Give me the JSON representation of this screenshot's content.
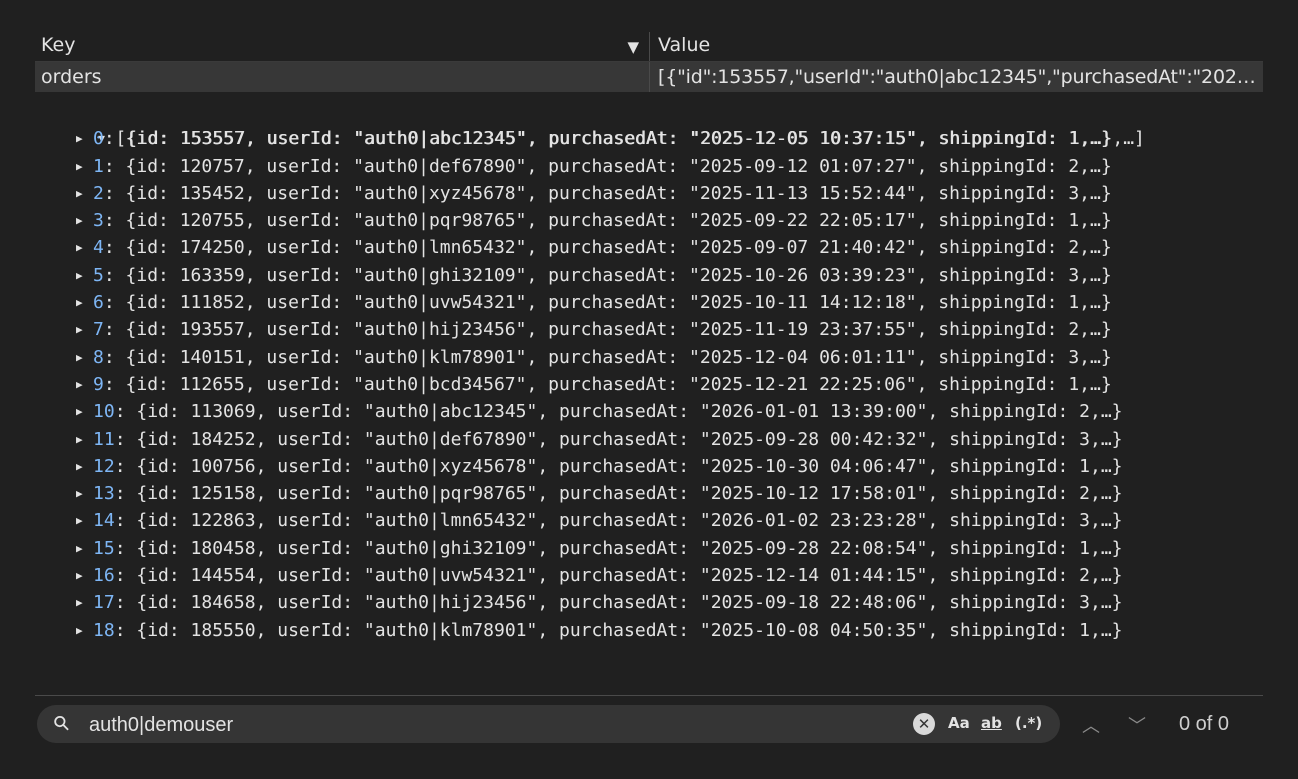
{
  "table": {
    "key_header": "Key",
    "value_header": "Value",
    "row": {
      "key": "orders",
      "value": "[{\"id\":153557,\"userId\":\"auth0|abc12345\",\"purchasedAt\":\"2025-12-..."
    }
  },
  "tree": {
    "root_summary": "[{id: 153557, userId: \"auth0|abc12345\", purchasedAt: \"2025-12-05 10:37:15\", shippingId: 1,…},…]",
    "items": [
      {
        "index": "0",
        "text": ": {id: 153557, userId: \"auth0|abc12345\", purchasedAt: \"2025-12-05 10:37:15\", shippingId: 1,…}"
      },
      {
        "index": "1",
        "text": ": {id: 120757, userId: \"auth0|def67890\", purchasedAt: \"2025-09-12 01:07:27\", shippingId: 2,…}"
      },
      {
        "index": "2",
        "text": ": {id: 135452, userId: \"auth0|xyz45678\", purchasedAt: \"2025-11-13 15:52:44\", shippingId: 3,…}"
      },
      {
        "index": "3",
        "text": ": {id: 120755, userId: \"auth0|pqr98765\", purchasedAt: \"2025-09-22 22:05:17\", shippingId: 1,…}"
      },
      {
        "index": "4",
        "text": ": {id: 174250, userId: \"auth0|lmn65432\", purchasedAt: \"2025-09-07 21:40:42\", shippingId: 2,…}"
      },
      {
        "index": "5",
        "text": ": {id: 163359, userId: \"auth0|ghi32109\", purchasedAt: \"2025-10-26 03:39:23\", shippingId: 3,…}"
      },
      {
        "index": "6",
        "text": ": {id: 111852, userId: \"auth0|uvw54321\", purchasedAt: \"2025-10-11 14:12:18\", shippingId: 1,…}"
      },
      {
        "index": "7",
        "text": ": {id: 193557, userId: \"auth0|hij23456\", purchasedAt: \"2025-11-19 23:37:55\", shippingId: 2,…}"
      },
      {
        "index": "8",
        "text": ": {id: 140151, userId: \"auth0|klm78901\", purchasedAt: \"2025-12-04 06:01:11\", shippingId: 3,…}"
      },
      {
        "index": "9",
        "text": ": {id: 112655, userId: \"auth0|bcd34567\", purchasedAt: \"2025-12-21 22:25:06\", shippingId: 1,…}"
      },
      {
        "index": "10",
        "text": ": {id: 113069, userId: \"auth0|abc12345\", purchasedAt: \"2026-01-01 13:39:00\", shippingId: 2,…}"
      },
      {
        "index": "11",
        "text": ": {id: 184252, userId: \"auth0|def67890\", purchasedAt: \"2025-09-28 00:42:32\", shippingId: 3,…}"
      },
      {
        "index": "12",
        "text": ": {id: 100756, userId: \"auth0|xyz45678\", purchasedAt: \"2025-10-30 04:06:47\", shippingId: 1,…}"
      },
      {
        "index": "13",
        "text": ": {id: 125158, userId: \"auth0|pqr98765\", purchasedAt: \"2025-10-12 17:58:01\", shippingId: 2,…}"
      },
      {
        "index": "14",
        "text": ": {id: 122863, userId: \"auth0|lmn65432\", purchasedAt: \"2026-01-02 23:23:28\", shippingId: 3,…}"
      },
      {
        "index": "15",
        "text": ": {id: 180458, userId: \"auth0|ghi32109\", purchasedAt: \"2025-09-28 22:08:54\", shippingId: 1,…}"
      },
      {
        "index": "16",
        "text": ": {id: 144554, userId: \"auth0|uvw54321\", purchasedAt: \"2025-12-14 01:44:15\", shippingId: 2,…}"
      },
      {
        "index": "17",
        "text": ": {id: 184658, userId: \"auth0|hij23456\", purchasedAt: \"2025-09-18 22:48:06\", shippingId: 3,…}"
      },
      {
        "index": "18",
        "text": ": {id: 185550, userId: \"auth0|klm78901\", purchasedAt: \"2025-10-08 04:50:35\", shippingId: 1,…}"
      }
    ]
  },
  "search": {
    "value": "auth0|demouser",
    "clear_icon": "✕",
    "match_case_label": "Aa",
    "whole_word_label": "ab",
    "regex_label": "(.*)",
    "prev_icon": "︿",
    "next_icon": "﹀",
    "match_count": "0 of 0"
  },
  "icons": {
    "sort": "sort-down-icon",
    "search": "search-icon",
    "expand": "triangle-right-icon",
    "collapse": "triangle-down-icon"
  },
  "colors": {
    "background": "#202020",
    "row_highlight": "#373737",
    "index_blue": "#7eb6f5",
    "search_bg": "#353535"
  }
}
